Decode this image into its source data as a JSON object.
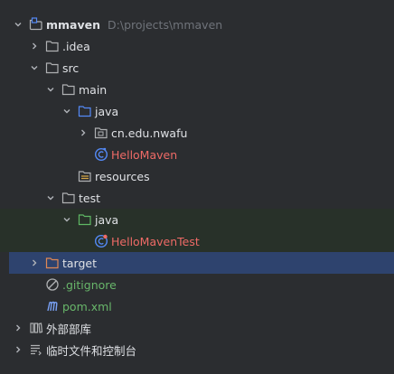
{
  "tree": {
    "project": {
      "name": "mmaven",
      "path": "D:\\projects\\mmaven"
    },
    "idea": ".idea",
    "src": "src",
    "main": "main",
    "main_java": "java",
    "package": "cn.edu.nwafu",
    "hello_maven": "HelloMaven",
    "resources": "resources",
    "test": "test",
    "test_java": "java",
    "hello_maven_test": "HelloMavenTest",
    "target": "target",
    "gitignore": ".gitignore",
    "pom": "pom.xml",
    "external_libs": "外部部库",
    "scratches": "临时文件和控制台"
  },
  "colors": {
    "background": "#2b2d30",
    "selected_row": "#2e436e",
    "test_row": "#283129",
    "modified_red": "#ee6a66",
    "added_green": "#68b66a",
    "path_gray": "#6f737a"
  }
}
